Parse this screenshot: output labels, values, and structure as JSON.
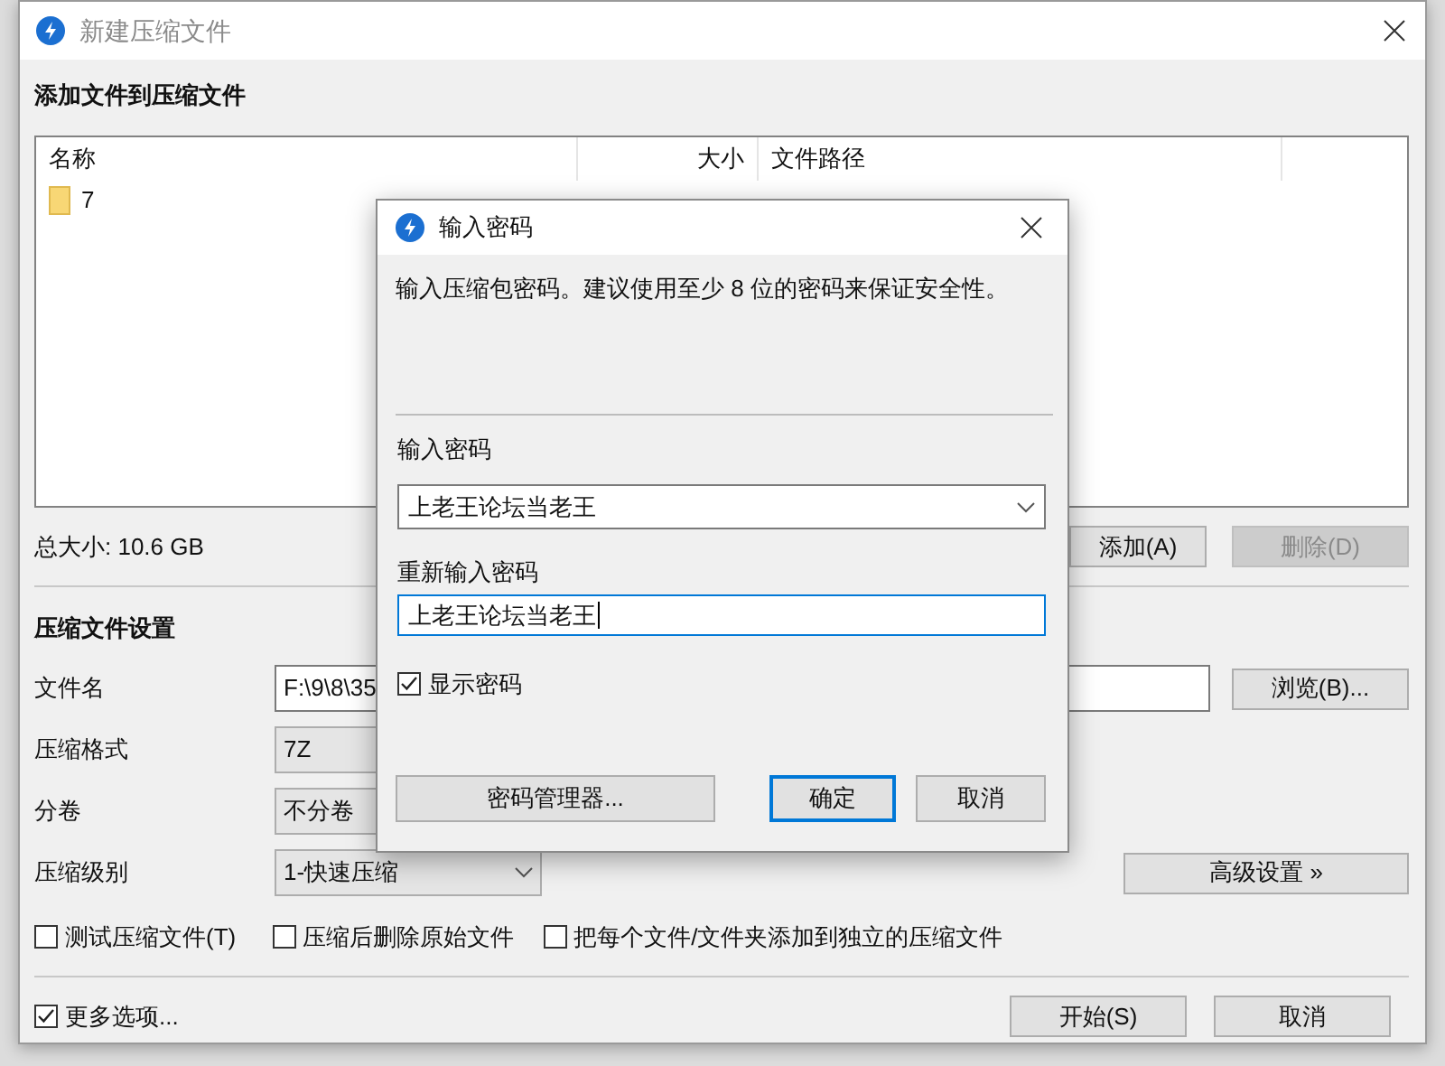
{
  "main_window": {
    "title": "新建压缩文件",
    "section_title": "添加文件到压缩文件",
    "file_list": {
      "columns": [
        "名称",
        "大小",
        "文件路径"
      ],
      "rows": [
        {
          "name": "7"
        }
      ]
    },
    "total_size": "总大小: 10.6 GB",
    "list_buttons": [
      {
        "label": "添加(A)",
        "disabled": false
      },
      {
        "label": "删除(D)",
        "disabled": true
      }
    ],
    "settings_title": "压缩文件设置",
    "settings": [
      {
        "kind": "text",
        "label": "文件名",
        "value": "F:\\9\\8\\35",
        "button": "浏览(B)..."
      },
      {
        "kind": "select",
        "label": "压缩格式",
        "value": "7Z"
      },
      {
        "kind": "select",
        "label": "分卷",
        "value": "不分卷"
      },
      {
        "kind": "select",
        "label": "压缩级别",
        "value": "1-快速压缩",
        "button": "高级设置 »"
      }
    ],
    "options": [
      {
        "label": "测试压缩文件(T)",
        "checked": false
      },
      {
        "label": "压缩后删除原始文件",
        "checked": false
      },
      {
        "label": "把每个文件/文件夹添加到独立的压缩文件",
        "checked": false
      }
    ],
    "more_options": {
      "label": "更多选项...",
      "checked": true
    },
    "buttons": [
      "开始(S)",
      "取消"
    ]
  },
  "password_dialog": {
    "title": "输入密码",
    "description": "输入压缩包密码。建议使用至少 8 位的密码来保证安全性。",
    "password_label": "输入密码",
    "password_value": "上老王论坛当老王",
    "confirm_label": "重新输入密码",
    "confirm_value": "上老王论坛当老王",
    "show_password": {
      "label": "显示密码",
      "checked": true
    },
    "buttons": [
      {
        "label": "密码管理器...",
        "kind": "normal"
      },
      {
        "label": "确定",
        "kind": "default"
      },
      {
        "label": "取消",
        "kind": "normal"
      }
    ]
  }
}
